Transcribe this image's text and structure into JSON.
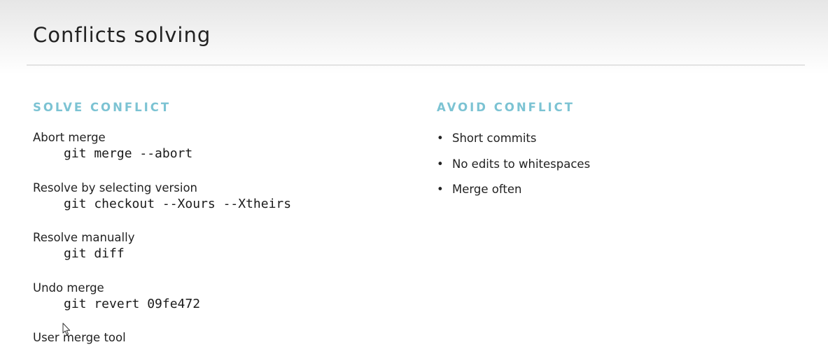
{
  "slide": {
    "title": "Conflicts solving"
  },
  "left": {
    "heading": "SOLVE CONFLICT",
    "entries": [
      {
        "label": "Abort merge",
        "command": "git merge --abort"
      },
      {
        "label": "Resolve by selecting version",
        "command": "git checkout --Xours --Xtheirs"
      },
      {
        "label": "Resolve manually",
        "command": "git diff"
      },
      {
        "label": "Undo merge",
        "command": "git revert 09fe472"
      },
      {
        "label": "User merge tool",
        "command": ""
      }
    ]
  },
  "right": {
    "heading": "AVOID CONFLICT",
    "bullets": [
      "Short commits",
      "No edits to whitespaces",
      "Merge often"
    ]
  },
  "colors": {
    "heading_accent": "#7cc3d3",
    "text": "#222222",
    "header_gradient_top": "#e6e6e6"
  },
  "icons": {
    "cursor": "mouse-pointer-icon",
    "bullet": "bullet-dot-icon"
  }
}
